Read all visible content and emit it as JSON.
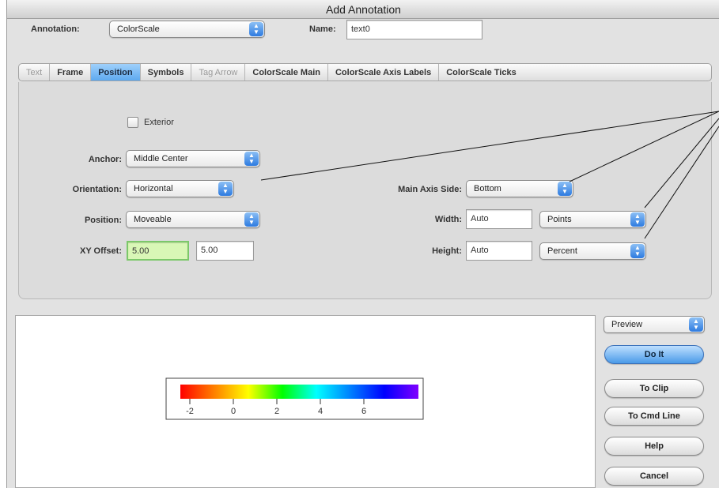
{
  "window": {
    "title": "Add Annotation"
  },
  "header": {
    "annotation_label": "Annotation:",
    "annotation_value": "ColorScale",
    "name_label": "Name:",
    "name_value": "text0"
  },
  "tabs": [
    {
      "label": "Text",
      "state": "disabled"
    },
    {
      "label": "Frame",
      "state": "normal"
    },
    {
      "label": "Position",
      "state": "selected"
    },
    {
      "label": "Symbols",
      "state": "normal"
    },
    {
      "label": "Tag Arrow",
      "state": "disabled"
    },
    {
      "label": "ColorScale Main",
      "state": "normal"
    },
    {
      "label": "ColorScale Axis Labels",
      "state": "normal"
    },
    {
      "label": "ColorScale Ticks",
      "state": "normal"
    }
  ],
  "position": {
    "exterior_label": "Exterior",
    "exterior_checked": false,
    "anchor_label": "Anchor:",
    "anchor_value": "Middle Center",
    "orientation_label": "Orientation:",
    "orientation_value": "Horizontal",
    "position_label": "Position:",
    "position_value": "Moveable",
    "xyoffset_label": "XY Offset:",
    "xoffset_value": "5.00",
    "yoffset_value": "5.00",
    "main_axis_side_label": "Main Axis Side:",
    "main_axis_side_value": "Bottom",
    "width_label": "Width:",
    "width_value": "Auto",
    "width_units": "Points",
    "height_label": "Height:",
    "height_value": "Auto",
    "height_units": "Percent"
  },
  "colorscale": {
    "ticks": [
      "-2",
      "0",
      "2",
      "4",
      "6"
    ],
    "gradient": [
      "#ff0000",
      "#ff8000",
      "#ffff00",
      "#00ff00",
      "#00ffff",
      "#0080ff",
      "#0000ff",
      "#8000ff"
    ]
  },
  "side": {
    "mode_value": "Preview",
    "do_it": "Do It",
    "to_clip": "To Clip",
    "to_cmd_line": "To Cmd Line",
    "help": "Help",
    "cancel": "Cancel"
  },
  "colors": {
    "accent": "#4a9ae8",
    "focus_field": "#d9f7b6"
  }
}
